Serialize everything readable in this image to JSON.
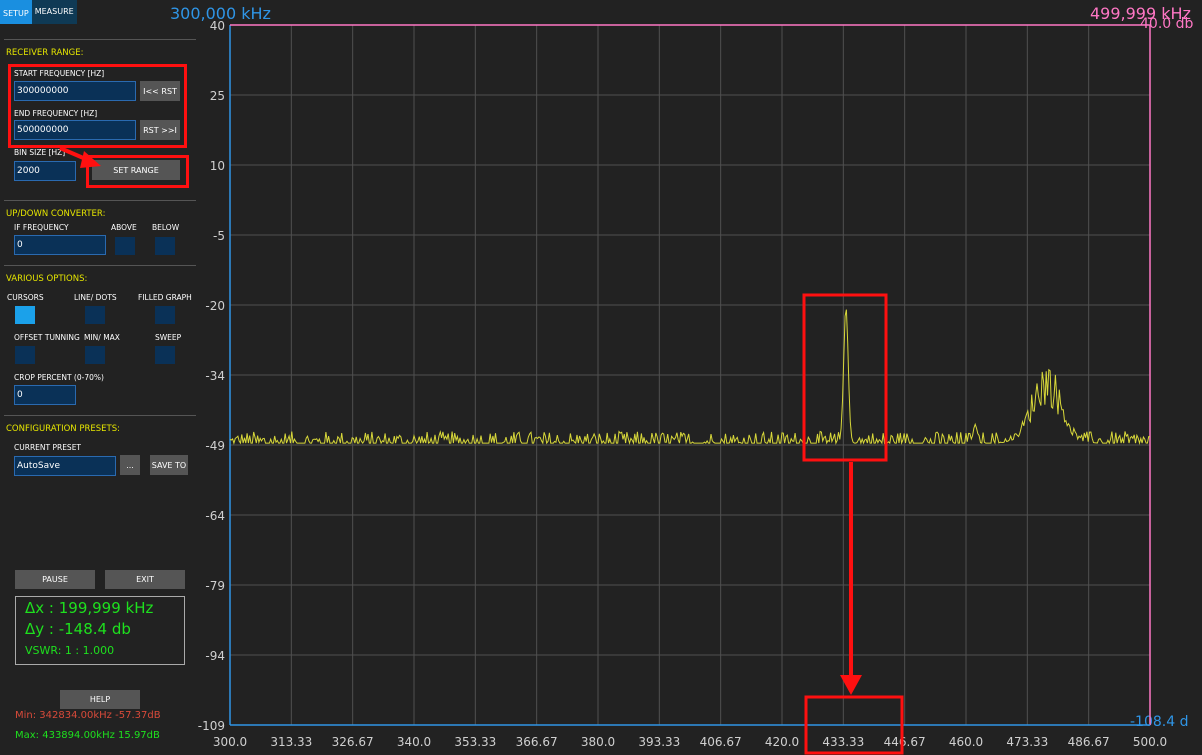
{
  "tabs": {
    "setup": "SETUP",
    "measure": "MEASURE"
  },
  "receiver": {
    "title": "RECEIVER RANGE:",
    "start_label": "START FREQUENCY [HZ]",
    "start_value": "300000000",
    "rst_left": "I<< RST",
    "end_label": "END FREQUENCY [HZ]",
    "end_value": "500000000",
    "rst_right": "RST >>I",
    "bin_label": "BIN SIZE [HZ]",
    "bin_value": "2000",
    "set_range": "SET RANGE"
  },
  "converter": {
    "title": "UP/DOWN CONVERTER:",
    "if_label": "IF FREQUENCY",
    "if_value": "0",
    "above": "ABOVE",
    "below": "BELOW"
  },
  "options": {
    "title": "VARIOUS OPTIONS:",
    "cursors": "CURSORS",
    "line_dots": "LINE/ DOTS",
    "filled_graph": "FILLED GRAPH",
    "offset_tuning": "OFFSET TUNNING",
    "min_max": "MIN/ MAX",
    "sweep": "SWEEP",
    "crop_label": "CROP PERCENT (0-70%)",
    "crop_value": "0"
  },
  "presets": {
    "title": "CONFIGURATION PRESETS:",
    "current_label": "CURRENT PRESET",
    "current_value": "AutoSave",
    "browse": "...",
    "save_to": "SAVE TO"
  },
  "controls": {
    "pause": "PAUSE",
    "exit": "EXIT",
    "help": "HELP"
  },
  "readout": {
    "dx": "Δx : 199,999 kHz",
    "dy": "Δy : -148.4 db",
    "vswr": "VSWR: 1 : 1.000",
    "min": "Min: 342834.00kHz -57.37dB",
    "max": "Max: 433894.00kHz 15.97dB"
  },
  "cursor_labels": {
    "left_freq": "300,000 kHz",
    "right_freq": "499,999 kHz",
    "top_db": "40.0 db",
    "bottom_db": "-108.4 d"
  },
  "colors": {
    "trace": "#d8d83a",
    "cursor_left": "#2f95e6",
    "cursor_right": "#ff77c5",
    "grid": "#505050",
    "highlight": "#ff1010"
  },
  "chart_data": {
    "type": "line",
    "x_range": [
      300.0,
      500.0
    ],
    "y_range": [
      -109,
      40
    ],
    "x_ticks": [
      "300.0",
      "313.33",
      "326.67",
      "340.0",
      "353.33",
      "366.67",
      "380.0",
      "393.33",
      "406.67",
      "420.0",
      "433.33",
      "446.67",
      "460.0",
      "473.33",
      "486.67",
      "500.0"
    ],
    "y_ticks": [
      "40",
      "25",
      "10",
      "-5",
      "-20",
      "-34",
      "-49",
      "-64",
      "-79",
      "-94",
      "-109"
    ],
    "noise_floor_db": -49,
    "peaks": [
      {
        "freq": 433.9,
        "db": -20,
        "width": 0.7
      },
      {
        "freq": 477.5,
        "db": -36,
        "width": 4.5
      },
      {
        "freq": 462.0,
        "db": -45,
        "width": 0.6
      }
    ]
  }
}
